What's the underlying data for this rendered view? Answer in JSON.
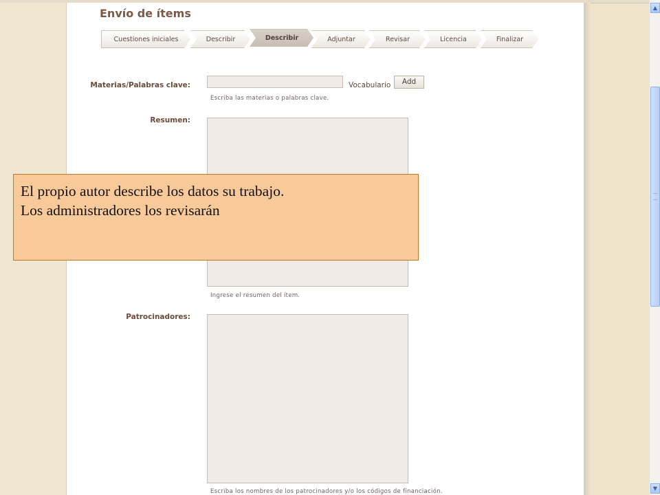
{
  "page": {
    "title": "Envío de ítems"
  },
  "steps": [
    {
      "label": "Cuestiones iniciales",
      "active": false
    },
    {
      "label": "Describir",
      "active": false
    },
    {
      "label": "Describir",
      "active": true
    },
    {
      "label": "Adjuntar",
      "active": false
    },
    {
      "label": "Revisar",
      "active": false
    },
    {
      "label": "Licencia",
      "active": false
    },
    {
      "label": "Finalizar",
      "active": false
    }
  ],
  "form": {
    "keywords": {
      "label": "Materias/Palabras clave:",
      "value": "",
      "vocab_link": "Vocabulario",
      "add_label": "Add",
      "hint": "Escriba las materias o palabras clave."
    },
    "abstract": {
      "label": "Resumen:",
      "value": "",
      "hint": "Ingrese el resumen del ítem."
    },
    "sponsors": {
      "label": "Patrocinadores:",
      "value": "",
      "hint": "Escriba los nombres de los patrocinadores y/o los códigos de financiación."
    }
  },
  "note": {
    "line1": "El propio autor describe los datos su trabajo.",
    "line2": "Los administradores los revisarán"
  },
  "scrollbar": {
    "up_icon": "arrow-up-icon",
    "down_icon": "arrow-down-icon"
  }
}
